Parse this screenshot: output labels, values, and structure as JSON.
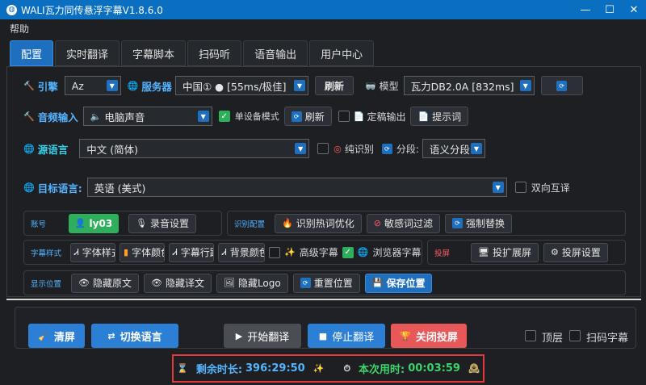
{
  "window": {
    "title": "WALI瓦力同传悬浮字幕V1.8.6.0",
    "minimize": "—",
    "maximize": "☐",
    "close": "✕"
  },
  "menu": {
    "help": "帮助"
  },
  "tabs": [
    "配置",
    "实时翻译",
    "字幕脚本",
    "扫码听",
    "语音输出",
    "用户中心"
  ],
  "row1": {
    "engine_label": "引擎",
    "engine_value": "Az",
    "server_label": "服务器",
    "server_value": "中国① ● [55ms/极佳]",
    "refresh": "刷新",
    "model_label": "模型",
    "model_value": "瓦力DB2.0A [832ms]"
  },
  "row2": {
    "audio_label": "音频输入",
    "audio_value": "电脑声音",
    "single_device": "单设备模式",
    "refresh": "刷新",
    "final_output": "定稿输出",
    "prompt": "提示词"
  },
  "row3": {
    "source_label": "源语言",
    "source_value": "中文 (简体)",
    "pure_recog": "纯识别",
    "segment_label": "分段:",
    "segment_value": "语义分段"
  },
  "row4": {
    "target_label": "目标语言:",
    "target_value": "英语 (美式)",
    "bidirectional": "双向互译"
  },
  "account": {
    "title": "账号",
    "user": "ly03",
    "record": "录音设置"
  },
  "recog": {
    "title": "识别配置",
    "hotword": "识别热词优化",
    "sensitive": "敏感词过滤",
    "replace": "强制替换"
  },
  "subtitle": {
    "title": "字幕样式",
    "font_style": "字体样式",
    "font_color": "字体颜色",
    "line_spacing": "字幕行距",
    "bg_color": "背景颜色",
    "advanced": "高级字幕",
    "browser": "浏览器字幕"
  },
  "projection": {
    "title": "投屏",
    "extend": "投扩展屏",
    "settings": "投屏设置"
  },
  "position": {
    "title": "显示位置",
    "hide_original": "隐藏原文",
    "hide_translation": "隐藏译文",
    "hide_logo": "隐藏Logo",
    "reset": "重置位置",
    "save": "保存位置"
  },
  "actions": {
    "clear": "清屏",
    "switch_lang": "切换语言",
    "start": "开始翻译",
    "stop": "停止翻译",
    "close_proj": "关闭投屏",
    "top_layer": "顶层",
    "scan_sub": "扫码字幕"
  },
  "status": {
    "remaining_label": "剩余时长:",
    "remaining_value": "396:29:50",
    "used_label": "本次用时:",
    "used_value": "00:03:59"
  },
  "colors": {
    "accent": "#1f6fbf",
    "green": "#2fae5c",
    "danger": "#e85858",
    "highlight": "#e23a3a"
  }
}
